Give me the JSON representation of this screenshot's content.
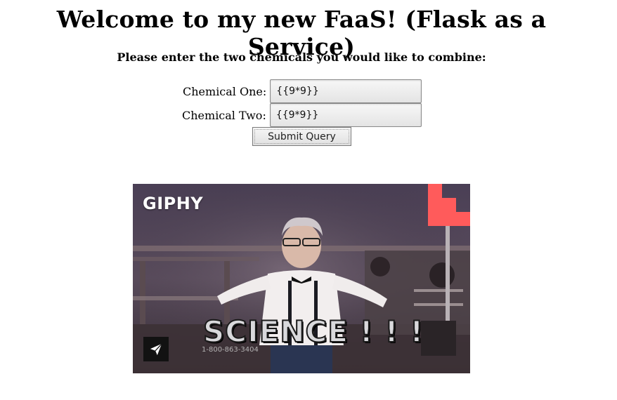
{
  "header": {
    "title": "Welcome to my new FaaS! (Flask as a Service)",
    "subtitle": "Please enter the two chemicals you would like to combine:"
  },
  "form": {
    "chemical_one": {
      "label": "Chemical One:",
      "value": "{{9*9}}"
    },
    "chemical_two": {
      "label": "Chemical Two:",
      "value": "{{9*9}}"
    },
    "submit_label": "Submit Query"
  },
  "gif": {
    "logo_text": "GIPHY",
    "caption": "SCIENCE ! ! !",
    "phone": "1-800-863-3404",
    "share_icon": "paper-plane-icon",
    "badge_color": "#ff5b5b"
  }
}
